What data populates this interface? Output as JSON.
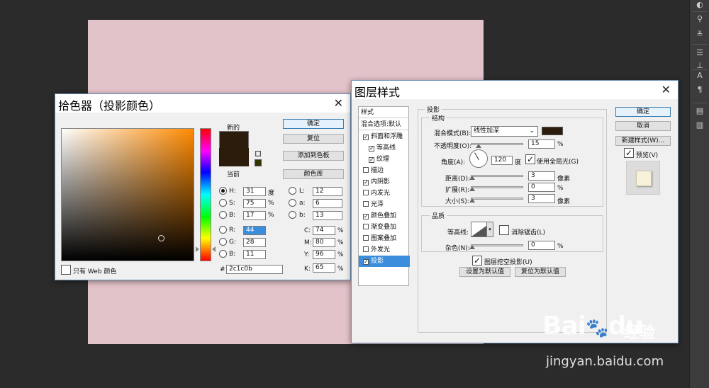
{
  "picker": {
    "title": "拾色器（投影颜色）",
    "new_label": "新的",
    "current_label": "当前",
    "ok": "确定",
    "reset": "复位",
    "add_swatch": "添加到色板",
    "color_lib": "颜色库",
    "web_only": "只有 Web 颜色",
    "hex_prefix": "#",
    "hex": "2c1c0b",
    "new_color": "#2c1c0b",
    "current_color": "#2c1c0b",
    "fields": {
      "h": {
        "label": "H:",
        "value": "31",
        "unit": "度"
      },
      "s": {
        "label": "S:",
        "value": "75",
        "unit": "%"
      },
      "b": {
        "label": "B:",
        "value": "17",
        "unit": "%"
      },
      "r": {
        "label": "R:",
        "value": "44"
      },
      "g": {
        "label": "G:",
        "value": "28"
      },
      "bb": {
        "label": "B:",
        "value": "11"
      },
      "l": {
        "label": "L:",
        "value": "12"
      },
      "a": {
        "label": "a:",
        "value": "6"
      },
      "lb": {
        "label": "b:",
        "value": "13"
      },
      "c": {
        "label": "C:",
        "value": "74",
        "unit": "%"
      },
      "m": {
        "label": "M:",
        "value": "80",
        "unit": "%"
      },
      "y": {
        "label": "Y:",
        "value": "96",
        "unit": "%"
      },
      "k": {
        "label": "K:",
        "value": "65",
        "unit": "%"
      }
    }
  },
  "layer_style": {
    "title": "图层样式",
    "styles_header": "样式",
    "blend_options": "混合选项:默认",
    "items": [
      {
        "label": "斜面和浮雕",
        "checked": true
      },
      {
        "label": "等高线",
        "checked": true
      },
      {
        "label": "纹理",
        "checked": true
      },
      {
        "label": "描边",
        "checked": false
      },
      {
        "label": "内阴影",
        "checked": true
      },
      {
        "label": "内发光",
        "checked": false
      },
      {
        "label": "光泽",
        "checked": false
      },
      {
        "label": "颜色叠加",
        "checked": true
      },
      {
        "label": "渐变叠加",
        "checked": false
      },
      {
        "label": "图案叠加",
        "checked": false
      },
      {
        "label": "外发光",
        "checked": false
      },
      {
        "label": "投影",
        "checked": true
      }
    ],
    "section": "投影",
    "structure": "结构",
    "blend_mode_label": "混合模式(B):",
    "blend_mode": "线性加深",
    "shadow_color": "#2c1c0b",
    "opacity_label": "不透明度(O):",
    "opacity": "15",
    "opacity_level": 0.15,
    "angle_label": "角度(A):",
    "angle": "120",
    "angle_unit": "度",
    "global_light": "使用全局光(G)",
    "distance_label": "距离(D):",
    "distance": "3",
    "spread_label": "扩展(R):",
    "spread": "0",
    "size_label": "大小(S):",
    "size": "3",
    "px_unit": "像素",
    "percent": "%",
    "quality": "品质",
    "contour_label": "等高线:",
    "antialias": "消除锯齿(L)",
    "noise_label": "杂色(N):",
    "noise": "0",
    "knockout": "图层挖空投影(U)",
    "make_default": "设置为默认值",
    "reset_default": "复位为默认值",
    "ok": "确定",
    "cancel": "取消",
    "new_style": "新建样式(W)...",
    "preview": "预览(V)"
  },
  "watermark": {
    "brand": "Bai",
    "brand2": "du",
    "cn": "经验",
    "url": "jingyan.baidu.com"
  }
}
